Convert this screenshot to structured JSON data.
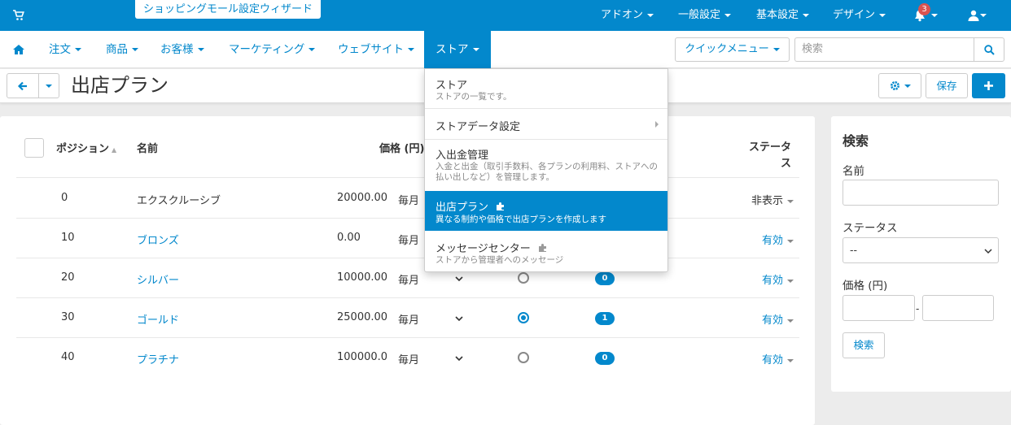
{
  "topbar": {
    "wizard": "ショッピングモール設定ウィザード",
    "menus": [
      "アドオン",
      "一般設定",
      "基本設定",
      "デザイン"
    ],
    "notifications": "3"
  },
  "nav": {
    "items": [
      "注文",
      "商品",
      "お客様",
      "マーケティング",
      "ウェブサイト",
      "ストア"
    ],
    "quick_menu": "クイックメニュー",
    "search_placeholder": "検索"
  },
  "title": {
    "page_title": "出店プラン",
    "save": "保存"
  },
  "table": {
    "headers": {
      "position": "ポジション",
      "name": "名前",
      "price": "価格 (円)",
      "status": "ステータス"
    },
    "rows": [
      {
        "position": "0",
        "name": "エクスクルーシブ",
        "price": "20000.00",
        "period": "毎月",
        "default": false,
        "count": null,
        "status": "非表示"
      },
      {
        "position": "10",
        "name": "ブロンズ",
        "price": "0.00",
        "period": "毎月",
        "default": false,
        "count": null,
        "status": "有効"
      },
      {
        "position": "20",
        "name": "シルバー",
        "price": "10000.00",
        "period": "毎月",
        "default": false,
        "count": "0",
        "status": "有効"
      },
      {
        "position": "30",
        "name": "ゴールド",
        "price": "25000.00",
        "period": "毎月",
        "default": true,
        "count": "1",
        "status": "有効"
      },
      {
        "position": "40",
        "name": "プラチナ",
        "price": "100000.00",
        "period": "毎月",
        "default": false,
        "count": "0",
        "status": "有効"
      }
    ]
  },
  "sidebar": {
    "title": "検索",
    "name_label": "名前",
    "status_label": "ステータス",
    "status_value": "--",
    "price_label": "価格 (円)",
    "range_sep": "-",
    "search_button": "検索"
  },
  "dropdown": {
    "items": [
      {
        "title": "ストア",
        "desc": "ストアの一覧です。"
      },
      {
        "title": "ストアデータ設定",
        "desc": ""
      },
      {
        "title": "入出金管理",
        "desc": "入金と出金（取引手数料、各プランの利用料、ストアへの払い出しなど）を管理します。"
      },
      {
        "title": "出店プラン",
        "desc": "異なる制約や価格で出店プランを作成します"
      },
      {
        "title": "メッセージセンター",
        "desc": "ストアから管理者へのメッセージ"
      }
    ]
  },
  "colors": {
    "accent": "#0388cc",
    "badge": "#d9534f"
  }
}
